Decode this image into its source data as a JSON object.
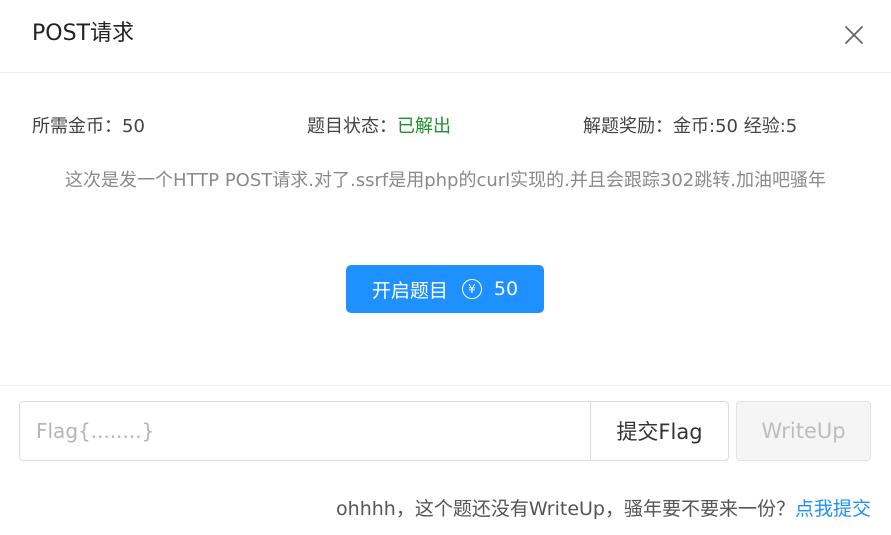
{
  "dialog": {
    "title": "POST请求",
    "close_icon": "close-icon"
  },
  "meta": {
    "coins_label": "所需金币：",
    "coins_value": "50",
    "status_label": "题目状态：",
    "status_value": "已解出",
    "status_color": "#1e8e2e",
    "reward_label": "解题奖励：",
    "reward_value": "金币:50 经验:5"
  },
  "description": "这次是发一个HTTP POST请求.对了.ssrf是用php的curl实现的.并且会跟踪302跳转.加油吧骚年",
  "start_button": {
    "label": "开启题目",
    "coin_icon": "yen-coin-icon",
    "coin_glyph": "¥",
    "cost": "50",
    "color": "#1e90ff"
  },
  "flag_form": {
    "placeholder": "Flag{........}",
    "value": "",
    "submit_label": "提交Flag",
    "writeup_label": "WriteUp"
  },
  "footer": {
    "note": "ohhhh，这个题还没有WriteUp，骚年要不要来一份？",
    "link_label": "点我提交",
    "link_color": "#1e90ff"
  }
}
